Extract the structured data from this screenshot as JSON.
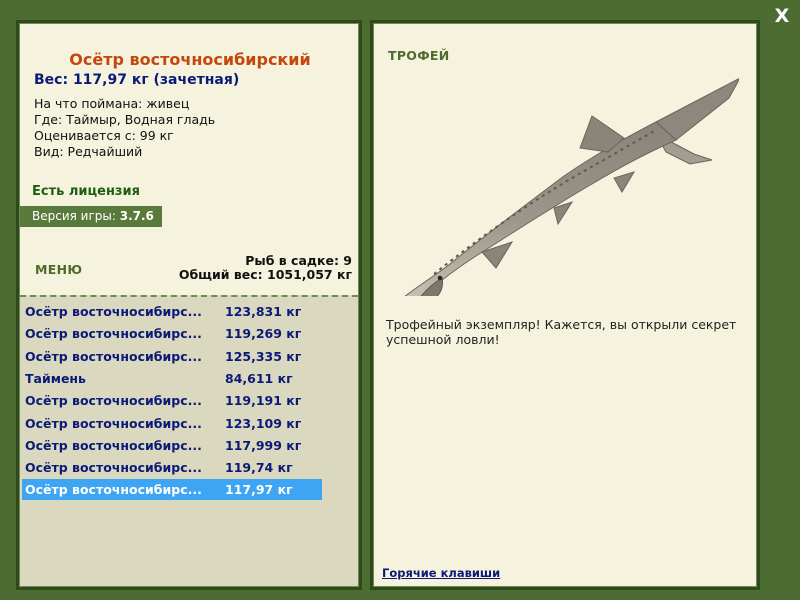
{
  "close": {
    "label": "X"
  },
  "fish": {
    "title": "Осётр восточносибирский",
    "weight": "Вес: 117,97 кг (зачетная)",
    "caught_on": "На что поймана: живец",
    "location": "Где: Таймыр, Водная гладь",
    "rated_from": "Оценивается с: 99 кг",
    "kind": "Вид: Редчайший"
  },
  "license": "Есть лицензия",
  "version": {
    "label": "Версия игры: ",
    "value": "3.7.6"
  },
  "menu": "МЕНЮ",
  "stats": {
    "count": "Рыб в садке: 9",
    "total": "Общий вес: 1051,057 кг"
  },
  "catch_list": [
    {
      "name": "Осётр восточносибирс...",
      "weight": "123,831 кг"
    },
    {
      "name": "Осётр восточносибирс...",
      "weight": "119,269 кг"
    },
    {
      "name": "Осётр восточносибирс...",
      "weight": "125,335 кг"
    },
    {
      "name": "Таймень",
      "weight": "84,611 кг"
    },
    {
      "name": "Осётр восточносибирс...",
      "weight": "119,191 кг"
    },
    {
      "name": "Осётр восточносибирс...",
      "weight": "123,109 кг"
    },
    {
      "name": "Осётр восточносибирс...",
      "weight": "117,999 кг"
    },
    {
      "name": "Осётр восточносибирс...",
      "weight": "119,74 кг"
    },
    {
      "name": "Осётр восточносибирс...",
      "weight": "117,97 кг"
    }
  ],
  "selected_index": 8,
  "trophy": {
    "label": "ТРОФЕЙ",
    "text": "Трофейный экземпляр! Кажется, вы открыли секрет успешной ловли!"
  },
  "hotkeys": "Горячие клавиши",
  "colors": {
    "bg": "#4c6c32",
    "panel": "#f5f2de",
    "title": "#c4480e",
    "navy": "#0b1a78",
    "selection": "#3da5f4"
  }
}
